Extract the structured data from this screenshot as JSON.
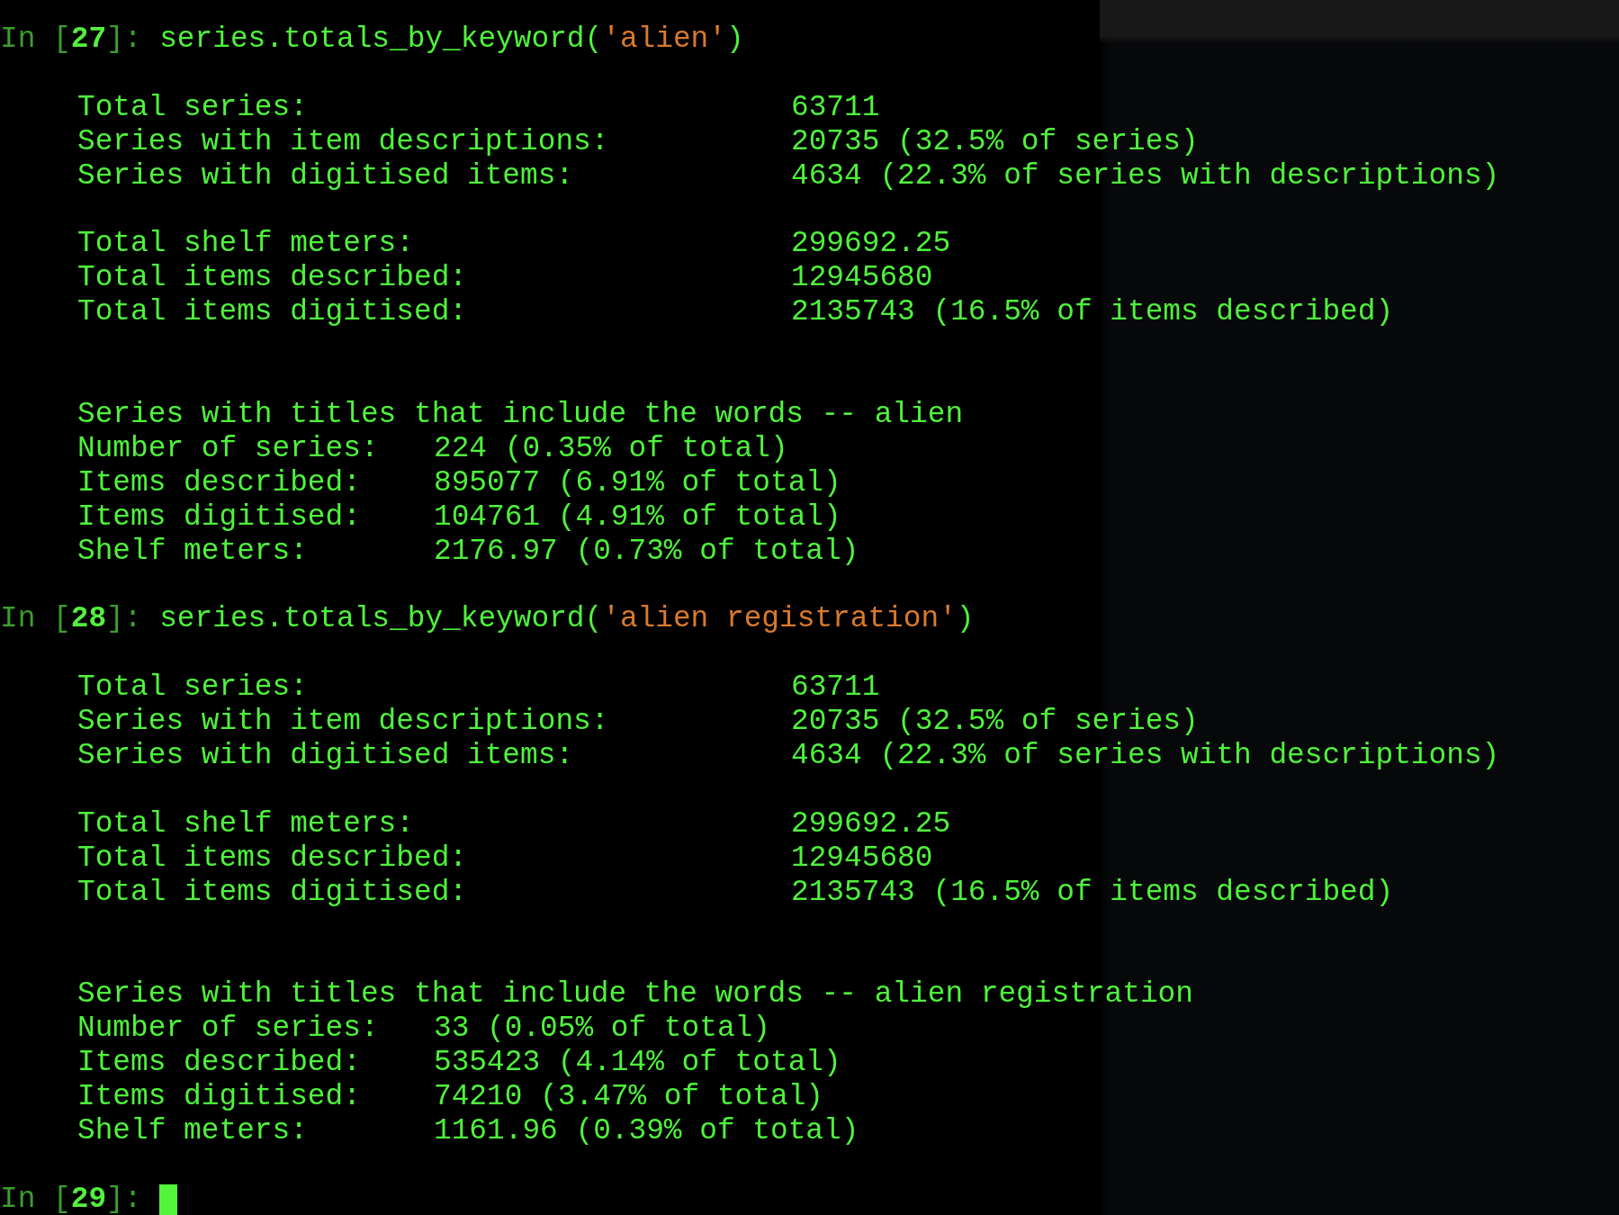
{
  "cells": [
    {
      "prompt": "In [**27**]:",
      "code": [
        {
          "kind": "plain",
          "text": "series.totals_by_keyword("
        },
        {
          "kind": "string",
          "text": "'alien'"
        },
        {
          "kind": "plain",
          "text": ")"
        }
      ],
      "output": {
        "totals": [
          [
            {
              "label": "Total series:",
              "value": "63711"
            },
            {
              "label": "Series with item descriptions:",
              "value": "20735 (32.5% of series)"
            },
            {
              "label": "Series with digitised items:",
              "value": "4634 (22.3% of series with descriptions)"
            }
          ],
          [
            {
              "label": "Total shelf meters:",
              "value": "299692.25"
            },
            {
              "label": "Total items described:",
              "value": "12945680"
            },
            {
              "label": "Total items digitised:",
              "value": "2135743 (16.5% of items described)"
            }
          ]
        ],
        "keyword_summary": {
          "heading": "Series with titles that include the words -- alien",
          "rows": [
            {
              "label": "Number of series:",
              "value": "224 (0.35% of total)"
            },
            {
              "label": "Items described:",
              "value": "895077 (6.91% of total)"
            },
            {
              "label": "Items digitised:",
              "value": "104761 (4.91% of total)"
            },
            {
              "label": "Shelf meters:",
              "value": "2176.97 (0.73% of total)"
            }
          ]
        }
      }
    },
    {
      "prompt": "In [**28**]:",
      "code": [
        {
          "kind": "plain",
          "text": "series.totals_by_keyword("
        },
        {
          "kind": "string",
          "text": "'alien registration'"
        },
        {
          "kind": "plain",
          "text": ")"
        }
      ],
      "output": {
        "totals": [
          [
            {
              "label": "Total series:",
              "value": "63711"
            },
            {
              "label": "Series with item descriptions:",
              "value": "20735 (32.5% of series)"
            },
            {
              "label": "Series with digitised items:",
              "value": "4634 (22.3% of series with descriptions)"
            }
          ],
          [
            {
              "label": "Total shelf meters:",
              "value": "299692.25"
            },
            {
              "label": "Total items described:",
              "value": "12945680"
            },
            {
              "label": "Total items digitised:",
              "value": "2135743 (16.5% of items described)"
            }
          ]
        ],
        "keyword_summary": {
          "heading": "Series with titles that include the words -- alien registration",
          "rows": [
            {
              "label": "Number of series:",
              "value": "33 (0.05% of total)"
            },
            {
              "label": "Items described:",
              "value": "535423 (4.14% of total)"
            },
            {
              "label": "Items digitised:",
              "value": "74210 (3.47% of total)"
            },
            {
              "label": "Shelf meters:",
              "value": "1161.96 (0.39% of total)"
            }
          ]
        }
      }
    },
    {
      "prompt": "In [**29**]:",
      "cursor": true
    }
  ]
}
